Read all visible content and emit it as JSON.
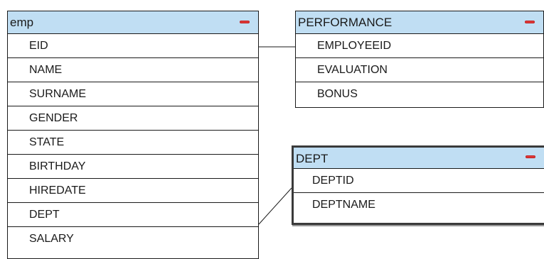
{
  "tables": {
    "emp": {
      "title": "emp",
      "fields": [
        "EID",
        "NAME",
        "SURNAME",
        "GENDER",
        "STATE",
        "BIRTHDAY",
        "HIREDATE",
        "DEPT",
        "SALARY"
      ]
    },
    "performance": {
      "title": "PERFORMANCE",
      "fields": [
        "EMPLOYEEID",
        "EVALUATION",
        "BONUS"
      ]
    },
    "dept": {
      "title": "DEPT",
      "fields": [
        "DEPTID",
        "DEPTNAME"
      ]
    }
  },
  "relationships": [
    {
      "from": "emp.EID",
      "to": "PERFORMANCE.EMPLOYEEID"
    },
    {
      "from": "emp.DEPT",
      "to": "DEPT.DEPTID"
    }
  ],
  "colors": {
    "header_background": "#c0def3",
    "border": "#1a1a1a",
    "minus_icon": "#e03a3a"
  },
  "icons": {
    "collapse": "minus-icon"
  }
}
